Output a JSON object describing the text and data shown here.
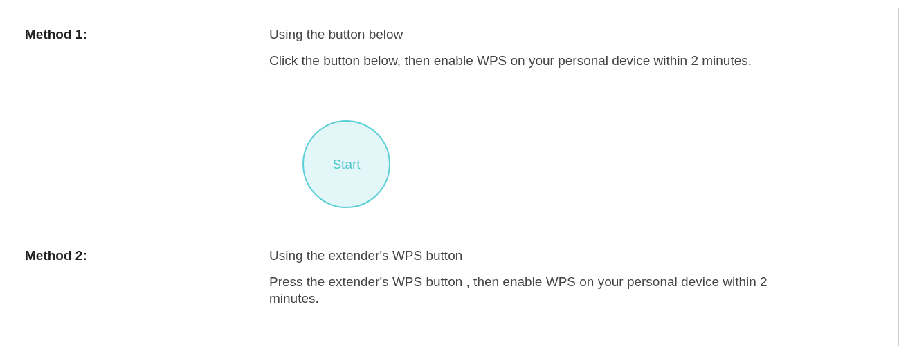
{
  "methods": [
    {
      "label": "Method 1:",
      "title": "Using the button below",
      "description": "Click the button below, then enable WPS on your personal device within 2 minutes.",
      "button": {
        "label": "Start"
      }
    },
    {
      "label": "Method 2:",
      "title": "Using the extender's WPS button",
      "description": "Press the extender's WPS button , then enable WPS on your personal device within 2 minutes."
    }
  ]
}
